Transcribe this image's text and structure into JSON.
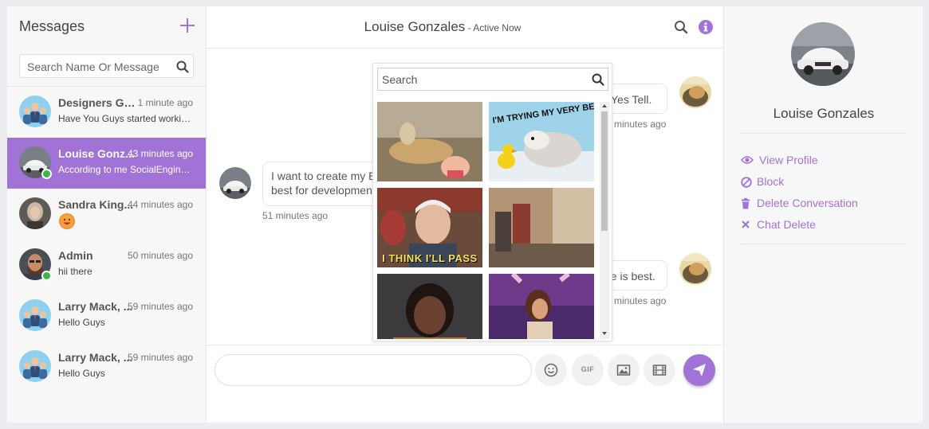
{
  "sidebar": {
    "title": "Messages",
    "search_placeholder": "Search Name Or Message",
    "conversations": [
      {
        "name": "Designers Gro...",
        "time": "1 minute ago",
        "preview": "Have You Guys started workin..."
      },
      {
        "name": "Louise Gonz...",
        "time": "43 minutes ago",
        "preview": "According to me SocialEngine..."
      },
      {
        "name": "Sandra King...",
        "time": "44 minutes ago",
        "preview": ""
      },
      {
        "name": "Admin",
        "time": "50 minutes ago",
        "preview": "hii there"
      },
      {
        "name": "Larry Mack, ...",
        "time": "59 minutes ago",
        "preview": "Hello Guys"
      },
      {
        "name": "Larry Mack, ...",
        "time": "59 minutes ago",
        "preview": "Hello Guys"
      }
    ]
  },
  "chat": {
    "contact_name": "Louise Gonzales",
    "status": " - Active Now",
    "messages": [
      {
        "text": "Yes Tell.",
        "time": "minutes ago"
      },
      {
        "line1": "I want to create my E",
        "line2": "best for developmen",
        "time": "51 minutes ago"
      },
      {
        "text": "ne is best.",
        "time": "minutes ago"
      }
    ],
    "composer_placeholder": "",
    "gif_label": "GIF"
  },
  "gif_picker": {
    "search_placeholder": "Search",
    "captions": {
      "gif2_top": "I'M TRYING MY VERY BEST",
      "gif3_bottom": "I THINK I'LL PASS"
    }
  },
  "profile": {
    "name": "Louise Gonzales",
    "actions": {
      "view_profile": "View Profile",
      "block": "Block",
      "delete_conversation": "Delete Conversation",
      "chat_delete": "Chat Delete"
    }
  },
  "colors": {
    "accent": "#a173d6",
    "online": "#3cb54a"
  }
}
